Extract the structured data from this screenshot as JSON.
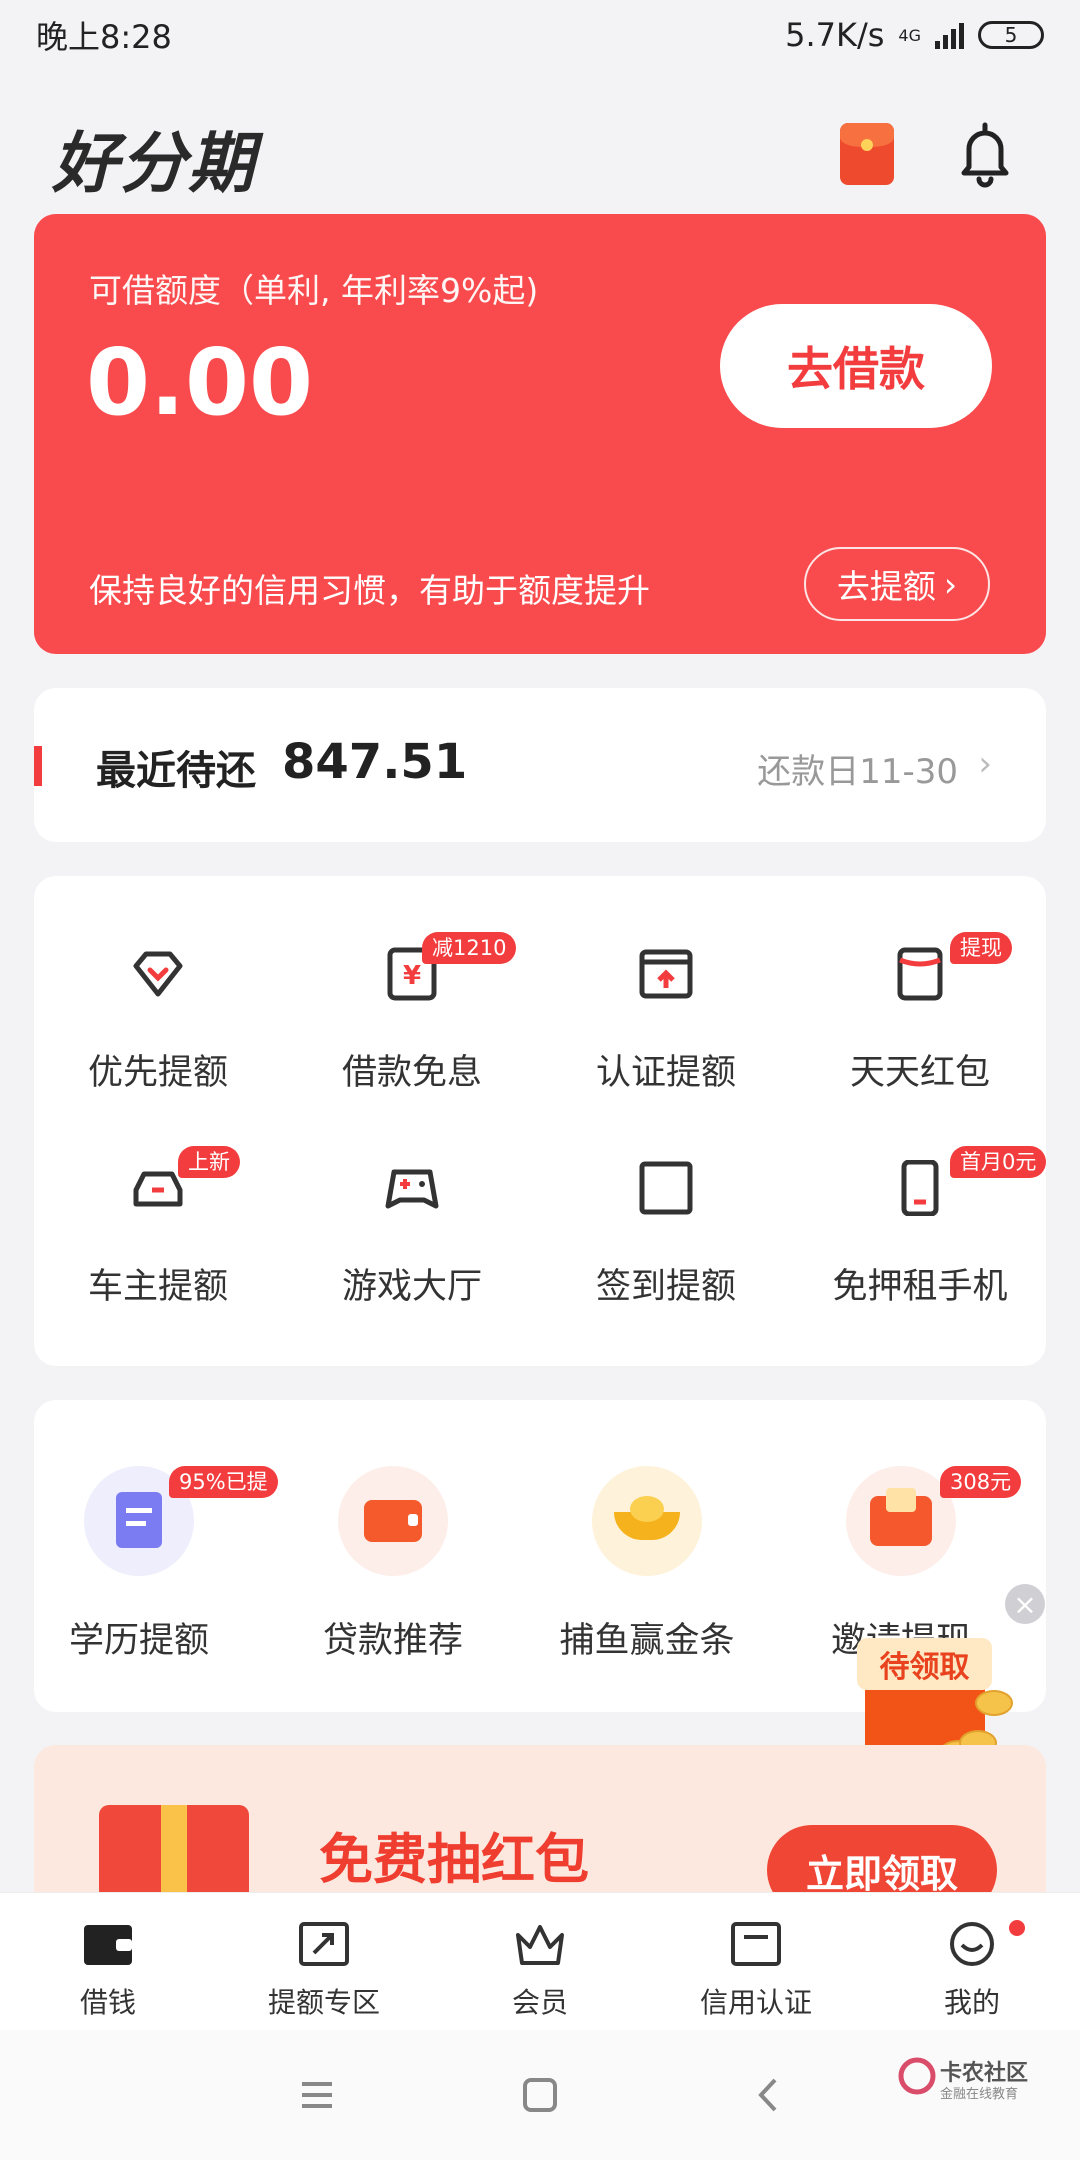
{
  "status_bar": {
    "time": "晚上8:28",
    "speed": "5.7K/s",
    "network": "4G",
    "battery": "5"
  },
  "header": {
    "logo": "好分期",
    "redpacket_icon": "red-envelope-icon",
    "bell_icon": "bell-icon"
  },
  "hero": {
    "label": "可借额度（单利, 年利率9%起)",
    "amount": "0.00",
    "borrow_button": "去借款",
    "tip": "保持良好的信用习惯，有助于额度提升",
    "raise_button": "去提额",
    "colors": {
      "background": "#f94b4d",
      "button_text": "#f23c3e"
    }
  },
  "repayment": {
    "label": "最近待还",
    "amount": "847.51",
    "due": "还款日11-30"
  },
  "grid": [
    {
      "label": "优先提额",
      "icon": "diamond-icon",
      "badge": ""
    },
    {
      "label": "借款免息",
      "icon": "yuan-doc-icon",
      "badge": "减1210"
    },
    {
      "label": "认证提额",
      "icon": "id-card-icon",
      "badge": ""
    },
    {
      "label": "天天红包",
      "icon": "red-packet-outline-icon",
      "badge": "提现"
    },
    {
      "label": "车主提额",
      "icon": "car-icon",
      "badge": "上新"
    },
    {
      "label": "游戏大厅",
      "icon": "gamepad-icon",
      "badge": ""
    },
    {
      "label": "签到提额",
      "icon": "checkin-icon",
      "badge": ""
    },
    {
      "label": "免押租手机",
      "icon": "phone-icon",
      "badge": "首月0元"
    }
  ],
  "services": [
    {
      "label": "学历提额",
      "icon": "clipboard-icon",
      "badge": "95%已提"
    },
    {
      "label": "贷款推荐",
      "icon": "wallet-icon",
      "badge": ""
    },
    {
      "label": "捕鱼赢金条",
      "icon": "gold-ingot-icon",
      "badge": ""
    },
    {
      "label": "邀请提现",
      "icon": "red-envelope-icon",
      "badge": "308元"
    }
  ],
  "floating_packet": {
    "label": "待领取",
    "close": "×"
  },
  "banner": {
    "title": "免费抽红包",
    "button": "立即领取"
  },
  "tabbar": [
    {
      "label": "借钱",
      "icon": "wallet-tab-icon"
    },
    {
      "label": "提额专区",
      "icon": "raise-tab-icon"
    },
    {
      "label": "会员",
      "icon": "crown-icon"
    },
    {
      "label": "信用认证",
      "icon": "card-tab-icon"
    },
    {
      "label": "我的",
      "icon": "smile-icon"
    }
  ],
  "watermark": {
    "title": "卡农社区",
    "subtitle": "金融在线教育"
  }
}
